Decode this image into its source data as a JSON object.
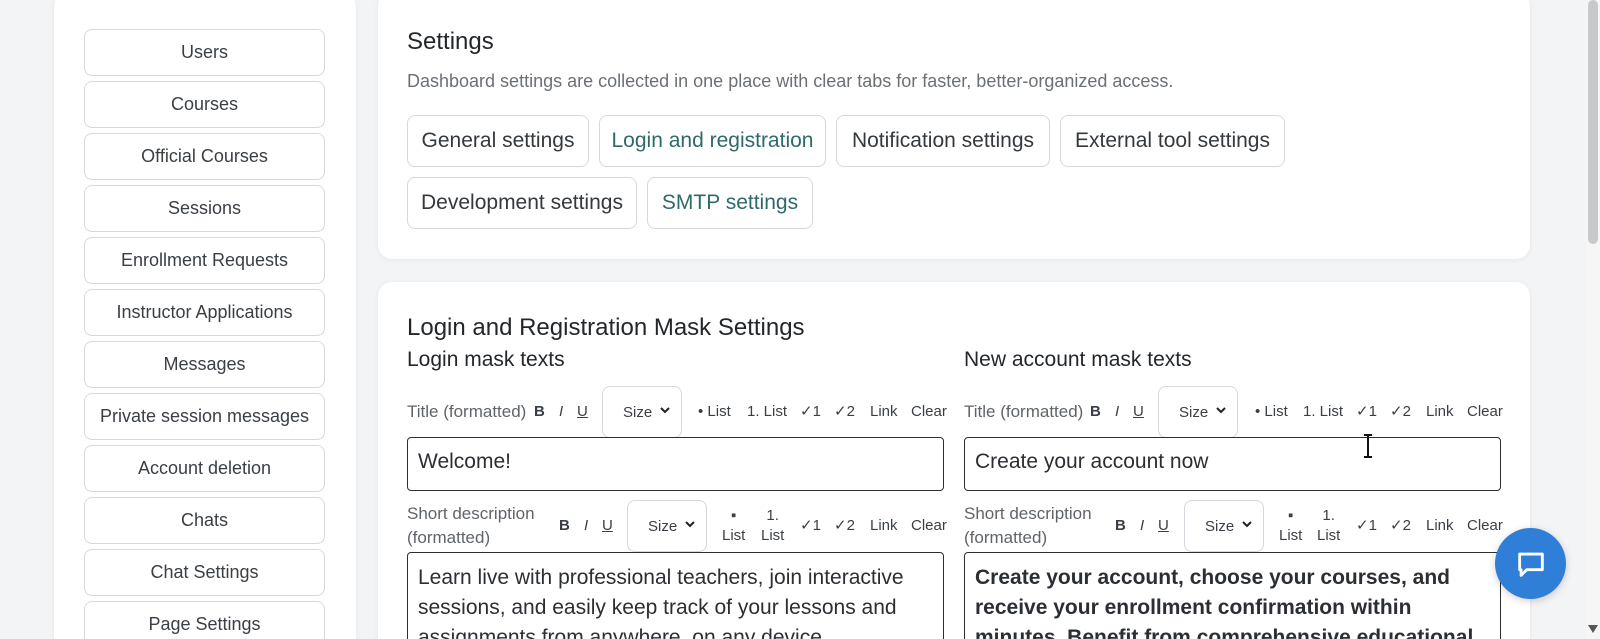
{
  "sidebar": {
    "items": [
      {
        "label": "Users"
      },
      {
        "label": "Courses"
      },
      {
        "label": "Official Courses"
      },
      {
        "label": "Sessions"
      },
      {
        "label": "Enrollment Requests"
      },
      {
        "label": "Instructor Applications"
      },
      {
        "label": "Messages"
      },
      {
        "label": "Private session messages"
      },
      {
        "label": "Account deletion"
      },
      {
        "label": "Chats"
      },
      {
        "label": "Chat Settings"
      },
      {
        "label": "Page Settings"
      }
    ]
  },
  "settings": {
    "title": "Settings",
    "subtitle": "Dashboard settings are collected in one place with clear tabs for faster, better-organized access.",
    "tabs": [
      {
        "label": "General settings"
      },
      {
        "label": "Login and registration"
      },
      {
        "label": "Notification settings"
      },
      {
        "label": "External tool settings"
      },
      {
        "label": "Development settings"
      },
      {
        "label": "SMTP settings"
      }
    ]
  },
  "mask": {
    "title": "Login and Registration Mask Settings",
    "login": {
      "heading": "Login mask texts",
      "title_label": "Title (formatted)",
      "title_value": "Welcome!",
      "desc_label_1": "Short description",
      "desc_label_2": "(formatted)",
      "desc_value": "Learn live with professional teachers, join interactive sessions, and easily keep track of your lessons and assignments from anywhere, on any device."
    },
    "register": {
      "heading": "New account mask texts",
      "title_label": "Title (formatted)",
      "title_value": "Create your account now",
      "desc_label_1": "Short description",
      "desc_label_2": "(formatted)",
      "desc_value": "Create your account, choose your courses, and receive your enrollment confirmation within minutes. Benefit from comprehensive educational services and features."
    },
    "toolbar": {
      "bold": "B",
      "italic": "I",
      "underline": "U",
      "size": "Size",
      "bullet_list": "• List",
      "ordered_list": "1. List",
      "bullet_glyph": "▪",
      "ordered_glyph": "1.",
      "list_word": "List",
      "check1": "✓1",
      "check2": "✓2",
      "link": "Link",
      "clear": "Clear"
    }
  },
  "icons": {
    "chat": "chat-bubble-icon",
    "chevron": "chevron-down-icon"
  },
  "colors": {
    "accent": "#2f7ed8",
    "active_tab": "#2d6a6a"
  }
}
